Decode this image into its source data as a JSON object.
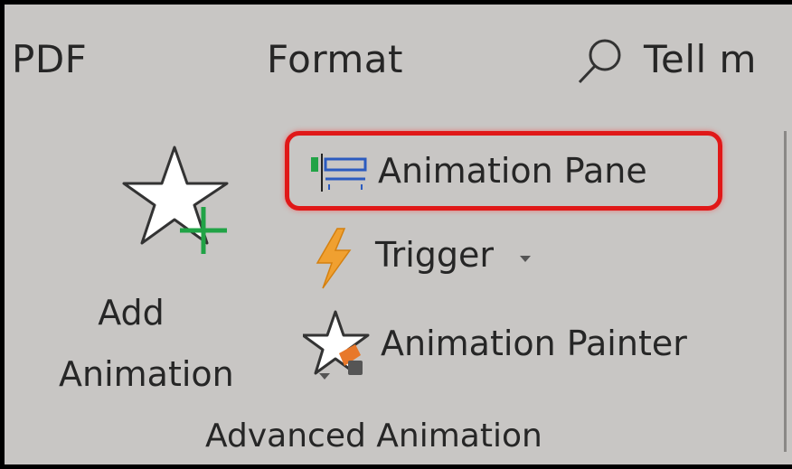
{
  "tabs": {
    "pdf": "PDF",
    "format": "Format",
    "tell": "Tell m"
  },
  "icons": {
    "search": "search-icon",
    "add_animation": "star-plus-icon",
    "animation_pane": "animation-pane-icon",
    "trigger": "lightning-icon",
    "animation_painter": "star-brush-icon"
  },
  "group": {
    "add_label_line1": "Add",
    "add_label_line2": "Animation",
    "animation_pane": "Animation Pane",
    "trigger": "Trigger",
    "animation_painter": "Animation Painter",
    "title": "Advanced Animation"
  },
  "colors": {
    "ribbon_bg": "#c8c6c4",
    "highlight": "#e01818",
    "plus_green": "#21a346",
    "trigger_orange": "#f0a030"
  }
}
